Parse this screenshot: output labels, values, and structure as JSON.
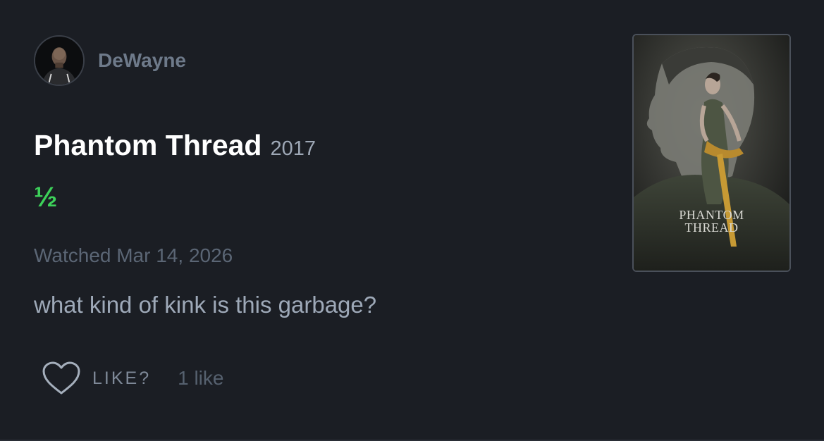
{
  "author": {
    "username": "DeWayne",
    "avatar_icon": "user-avatar-photo"
  },
  "film": {
    "title": "Phantom Thread",
    "year": "2017",
    "rating": "½",
    "rating_value": 0.5,
    "rating_max": 5
  },
  "review": {
    "watched": "Watched Mar 14, 2026",
    "text": "what kind of kink is this garbage?"
  },
  "actions": {
    "like_icon": "heart-outline-icon",
    "like_label": "LIKE?",
    "like_count": "1 like"
  },
  "poster": {
    "title_line1": "PHANTOM",
    "title_line2": "THREAD"
  },
  "colors": {
    "background": "#1b1e24",
    "rating_green": "#3dd15a",
    "username": "#6e7a8a",
    "title": "#ffffff"
  }
}
